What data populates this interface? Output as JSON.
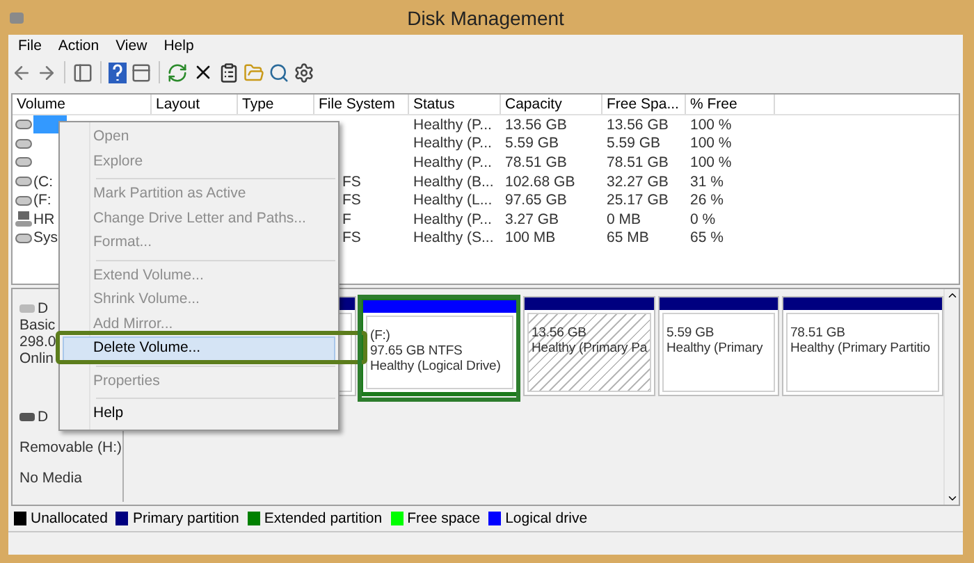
{
  "window": {
    "title": "Disk Management"
  },
  "menu_bar": [
    "File",
    "Action",
    "View",
    "Help"
  ],
  "table": {
    "columns": [
      "Volume",
      "Layout",
      "Type",
      "File System",
      "Status",
      "Capacity",
      "Free Spa...",
      "% Free"
    ],
    "rows": [
      {
        "kind": "drive",
        "selected": true,
        "status": "Healthy (P...",
        "capacity": "13.56 GB",
        "free_space": "13.56 GB",
        "percent_free": "100 %"
      },
      {
        "kind": "drive",
        "selected": false,
        "status": "Healthy (P...",
        "capacity": "5.59 GB",
        "free_space": "5.59 GB",
        "percent_free": "100 %"
      },
      {
        "kind": "drive",
        "selected": false,
        "status": "Healthy (P...",
        "capacity": "78.51 GB",
        "free_space": "78.51 GB",
        "percent_free": "100 %"
      },
      {
        "kind": "drive",
        "selected": false,
        "volume": "(C:",
        "file_system": "FS",
        "status": "Healthy (B...",
        "capacity": "102.68 GB",
        "free_space": "32.27 GB",
        "percent_free": "31 %"
      },
      {
        "kind": "drive",
        "selected": false,
        "volume": "(F:",
        "file_system": "FS",
        "status": "Healthy (L...",
        "capacity": "97.65 GB",
        "free_space": "25.17 GB",
        "percent_free": "26 %"
      },
      {
        "kind": "device",
        "selected": false,
        "volume": "HR",
        "file_system": "F",
        "status": "Healthy (P...",
        "capacity": "3.27 GB",
        "free_space": "0 MB",
        "percent_free": "0 %"
      },
      {
        "kind": "drive",
        "selected": false,
        "volume": "Sys",
        "file_system": "FS",
        "status": "Healthy (S...",
        "capacity": "100 MB",
        "free_space": "65 MB",
        "percent_free": "65 %"
      }
    ]
  },
  "disks": [
    {
      "kind": "fixed",
      "name": "D",
      "lines": [
        "Basic",
        "298.0",
        "Onlin"
      ],
      "partitions": [
        {
          "kind": "primary"
        },
        {
          "kind": "logical",
          "selected": false,
          "lines": [
            "(F:)",
            "97.65 GB NTFS",
            "Healthy (Logical Drive)"
          ]
        },
        {
          "kind": "primary",
          "selected": true,
          "lines": [
            "13.56 GB",
            "Healthy (Primary Pa"
          ]
        },
        {
          "kind": "primary",
          "selected": false,
          "lines": [
            "5.59 GB",
            "Healthy (Primary"
          ]
        },
        {
          "kind": "primary",
          "selected": false,
          "lines": [
            "78.51 GB",
            "Healthy (Primary Partitio"
          ]
        }
      ]
    },
    {
      "kind": "removable",
      "name": "D",
      "lines": [
        "Removable (H:)",
        "No Media"
      ]
    }
  ],
  "legend": [
    {
      "label": "Unallocated",
      "color": "#000000"
    },
    {
      "label": "Primary partition",
      "color": "#000080"
    },
    {
      "label": "Extended partition",
      "color": "#008000"
    },
    {
      "label": "Free space",
      "color": "#00ff00"
    },
    {
      "label": "Logical drive",
      "color": "#0000ff"
    }
  ],
  "context_menu": [
    {
      "kind": "item",
      "label": "Open",
      "disabled": true,
      "selected": false
    },
    {
      "kind": "item",
      "label": "Explore",
      "disabled": true,
      "selected": false
    },
    {
      "kind": "separator"
    },
    {
      "kind": "item",
      "label": "Mark Partition as Active",
      "disabled": true,
      "selected": false
    },
    {
      "kind": "item",
      "label": "Change Drive Letter and Paths...",
      "disabled": true,
      "selected": false
    },
    {
      "kind": "item",
      "label": "Format...",
      "disabled": true,
      "selected": false
    },
    {
      "kind": "separator"
    },
    {
      "kind": "item",
      "label": "Extend Volume...",
      "disabled": true,
      "selected": false
    },
    {
      "kind": "item",
      "label": "Shrink Volume...",
      "disabled": true,
      "selected": false
    },
    {
      "kind": "item",
      "label": "Add Mirror...",
      "disabled": true,
      "selected": false
    },
    {
      "kind": "item",
      "label": "Delete Volume...",
      "disabled": false,
      "selected": true
    },
    {
      "kind": "separator"
    },
    {
      "kind": "item",
      "label": "Properties",
      "disabled": true,
      "selected": false
    },
    {
      "kind": "separator"
    },
    {
      "kind": "item",
      "label": "Help",
      "disabled": false,
      "selected": false
    }
  ]
}
